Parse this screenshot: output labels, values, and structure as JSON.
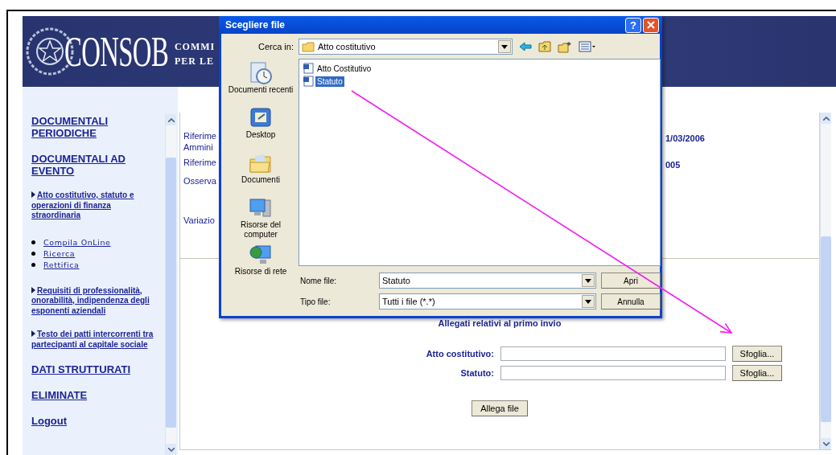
{
  "header": {
    "logo_text": "CONSOB",
    "tagline_lines": [
      "COMMI",
      "PER LE"
    ]
  },
  "sidebar": {
    "items": [
      {
        "kind": "section",
        "label": "DOCUMENTALI PERIODICHE"
      },
      {
        "kind": "section",
        "label": "DOCUMENTALI AD EVENTO"
      },
      {
        "kind": "subsection",
        "label": "Atto costitutivo, statuto e operazioni di finanza straordinaria"
      },
      {
        "kind": "link",
        "label": "Compila OnLine"
      },
      {
        "kind": "link",
        "label": "Ricerca"
      },
      {
        "kind": "link",
        "label": "Rettifica"
      },
      {
        "kind": "subsection",
        "label": "Requisiti di professionalità, onorabilità, indipendenza degli esponenti aziendali"
      },
      {
        "kind": "subsection",
        "label": "Testo dei patti intercorrenti tra partecipanti al capitale sociale"
      },
      {
        "kind": "section",
        "label": "DATI STRUTTURATI"
      },
      {
        "kind": "section",
        "label": "ELIMINATE"
      },
      {
        "kind": "section",
        "label": "Logout"
      }
    ]
  },
  "content": {
    "rows": [
      {
        "label_lines": [
          "Riferime",
          "Ammini"
        ],
        "value": "1/03/2006"
      },
      {
        "label_lines": [
          "Riferime"
        ],
        "value": "005"
      },
      {
        "label_lines": [
          "Osserva"
        ]
      },
      {
        "label_lines": [
          "Variazio"
        ]
      }
    ],
    "attachments": {
      "title": "Allegati relativi al primo invio",
      "fields": [
        {
          "label": "Atto costitutivo:",
          "button": "Sfoglia..."
        },
        {
          "label": "Statuto:",
          "button": "Sfoglia..."
        }
      ],
      "submit": "Allega file"
    }
  },
  "dialog": {
    "title": "Scegliere file",
    "help": "?",
    "look_in_label": "Cerca in:",
    "look_in_value": "Atto costitutivo",
    "places": [
      {
        "kind": "recent",
        "label": "Documenti recenti"
      },
      {
        "kind": "desktop",
        "label": "Desktop"
      },
      {
        "kind": "documents",
        "label": "Documenti"
      },
      {
        "kind": "computer",
        "label": "Risorse del computer"
      },
      {
        "kind": "network",
        "label": "Risorse di rete"
      }
    ],
    "files": [
      {
        "name": "Atto Costitutivo",
        "selected": false
      },
      {
        "name": "Statuto",
        "selected": true
      }
    ],
    "file_name_label": "Nome file:",
    "file_name_value": "Statuto",
    "file_type_label": "Tipo file:",
    "file_type_value": "Tutti i file (*.*)",
    "buttons": [
      "Apri",
      "Annulla"
    ]
  }
}
